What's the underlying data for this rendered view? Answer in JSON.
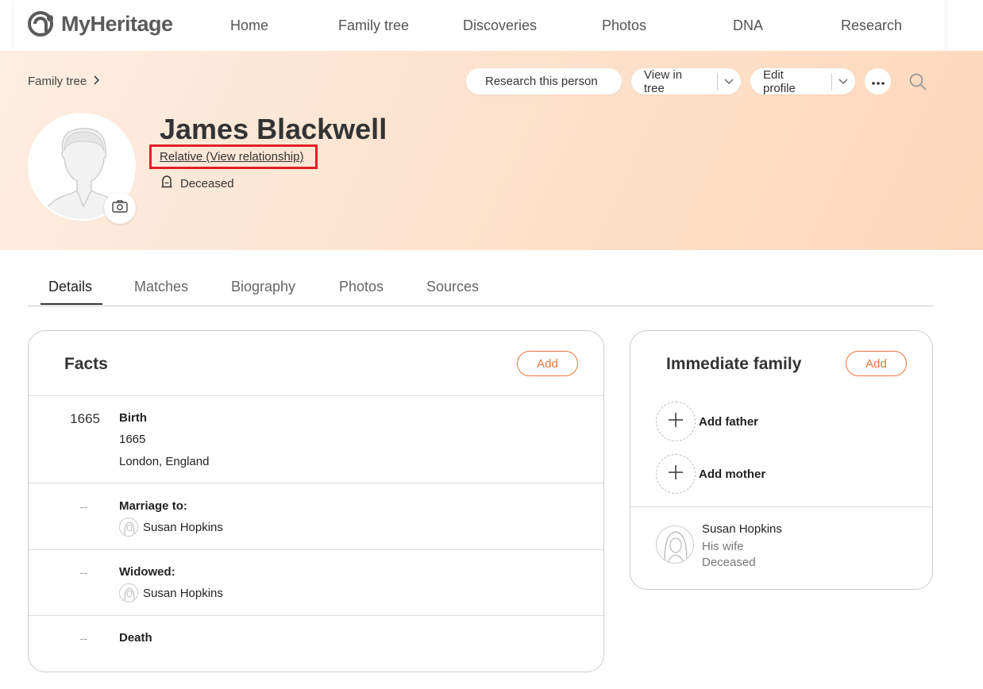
{
  "brand": {
    "name": "MyHeritage"
  },
  "nav": [
    "Home",
    "Family tree",
    "Discoveries",
    "Photos",
    "DNA",
    "Research"
  ],
  "breadcrumb": {
    "label": "Family tree"
  },
  "actions": {
    "research": "Research this person",
    "view_tree": "View in tree",
    "edit_profile": "Edit profile"
  },
  "person": {
    "name": "James Blackwell",
    "relationship": "Relative (View relationship)",
    "status": "Deceased"
  },
  "tabs": [
    "Details",
    "Matches",
    "Biography",
    "Photos",
    "Sources"
  ],
  "facts": {
    "title": "Facts",
    "add_label": "Add",
    "items": [
      {
        "year": "1665",
        "type": "Birth",
        "date": "1665",
        "place": "London, England"
      },
      {
        "year": "--",
        "type": "Marriage to:",
        "person": "Susan Hopkins"
      },
      {
        "year": "--",
        "type": "Widowed:",
        "person": "Susan Hopkins"
      },
      {
        "year": "--",
        "type": "Death"
      }
    ]
  },
  "family": {
    "title": "Immediate family",
    "add_label": "Add",
    "add_father": "Add father",
    "add_mother": "Add mother",
    "members": [
      {
        "name": "Susan Hopkins",
        "relation": "His wife",
        "status": "Deceased"
      }
    ]
  },
  "colors": {
    "accent": "#e8743b",
    "highlight": "#e0202a",
    "hero": "#fde3cf"
  }
}
